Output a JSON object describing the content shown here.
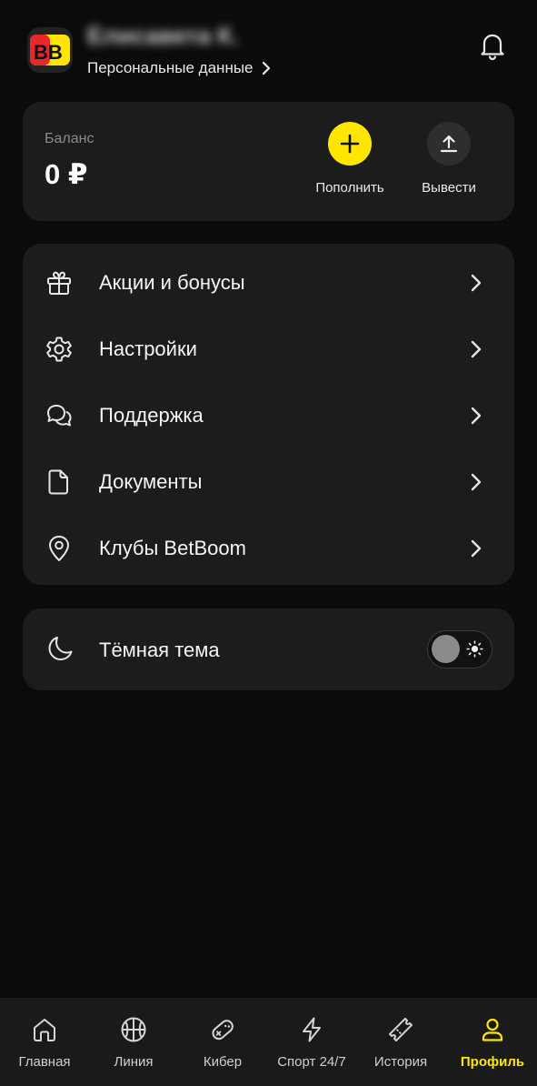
{
  "header": {
    "user_name": "Елисавета К.",
    "personal_link": "Персональные данные",
    "avatar_logo": "BB"
  },
  "balance": {
    "label": "Баланс",
    "value": "0 ₽",
    "topup_label": "Пополнить",
    "withdraw_label": "Вывести"
  },
  "menu": {
    "items": [
      {
        "label": "Акции и бонусы",
        "icon": "gift-icon"
      },
      {
        "label": "Настройки",
        "icon": "gear-icon"
      },
      {
        "label": "Поддержка",
        "icon": "chat-icon"
      },
      {
        "label": "Документы",
        "icon": "document-icon"
      },
      {
        "label": "Клубы BetBoom",
        "icon": "location-pin-icon"
      }
    ]
  },
  "theme": {
    "label": "Тёмная тема",
    "enabled": false
  },
  "nav": {
    "items": [
      {
        "label": "Главная",
        "icon": "home-icon",
        "active": false
      },
      {
        "label": "Линия",
        "icon": "basketball-icon",
        "active": false
      },
      {
        "label": "Кибер",
        "icon": "gamepad-icon",
        "active": false
      },
      {
        "label": "Спорт 24/7",
        "icon": "lightning-icon",
        "active": false
      },
      {
        "label": "История",
        "icon": "ticket-icon",
        "active": false
      },
      {
        "label": "Профиль",
        "icon": "user-icon",
        "active": true
      }
    ]
  },
  "colors": {
    "accent": "#ffe600",
    "background": "#0b0b0b",
    "card": "#1c1c1c",
    "nav_bar": "#1a1a1a"
  }
}
